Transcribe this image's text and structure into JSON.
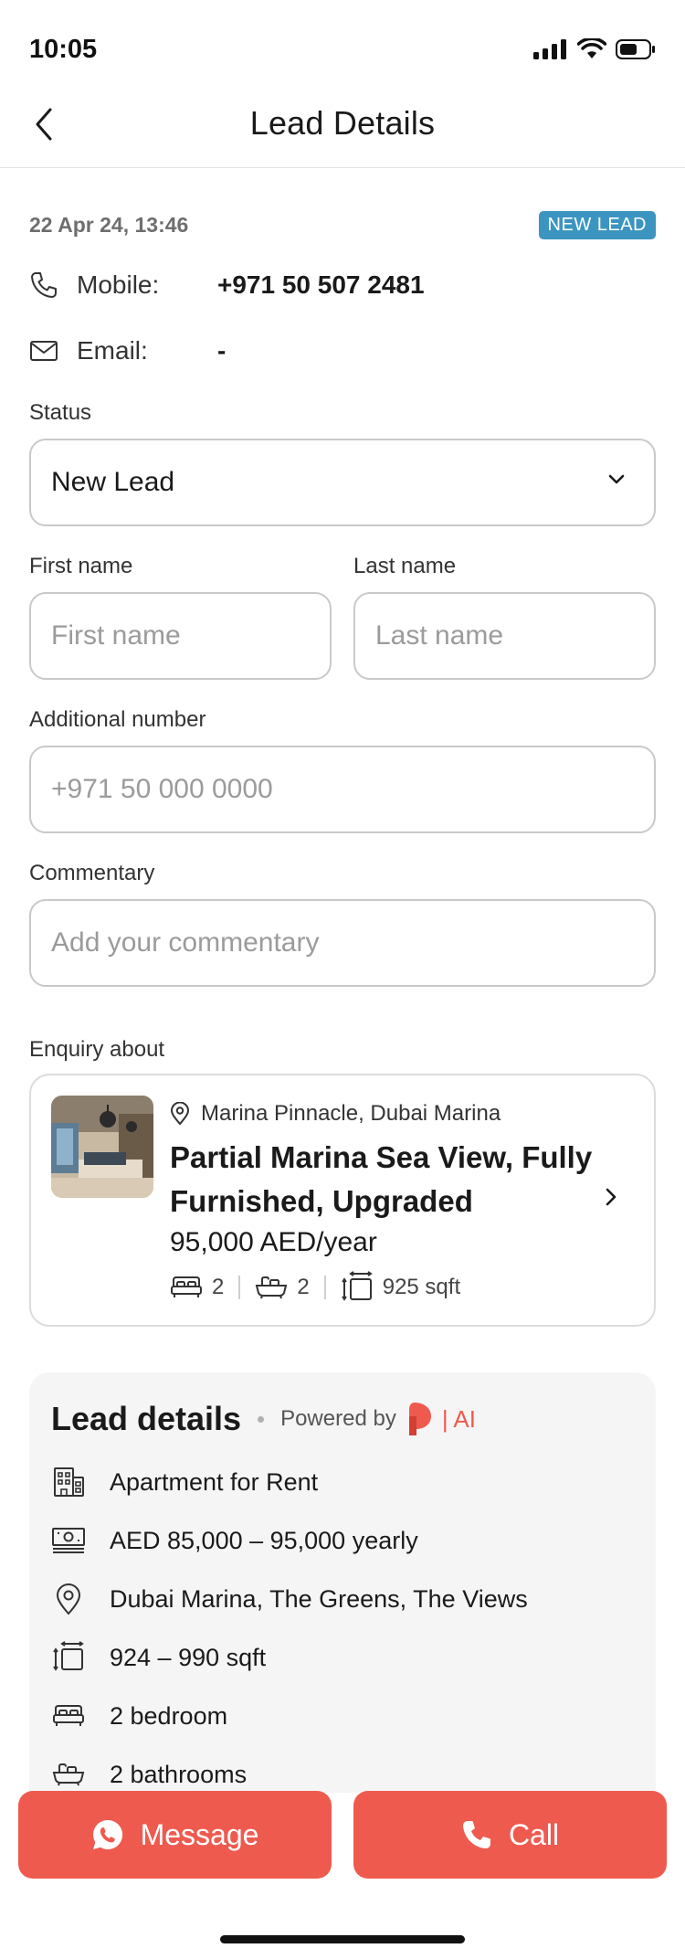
{
  "status_bar": {
    "time": "10:05"
  },
  "nav": {
    "title": "Lead Details"
  },
  "lead": {
    "date": "22 Apr 24, 13:46",
    "badge": "NEW LEAD",
    "mobile_label": "Mobile:",
    "mobile_value": "+971 50 507 2481",
    "email_label": "Email:",
    "email_value": "-"
  },
  "form": {
    "status_label": "Status",
    "status_value": "New Lead",
    "first_name_label": "First name",
    "first_name_placeholder": "First name",
    "last_name_label": "Last name",
    "last_name_placeholder": "Last name",
    "additional_number_label": "Additional number",
    "additional_number_placeholder": "+971 50 000 0000",
    "commentary_label": "Commentary",
    "commentary_placeholder": "Add your commentary"
  },
  "enquiry": {
    "section_label": "Enquiry about",
    "location": "Marina Pinnacle, Dubai Marina",
    "title": "Partial Marina Sea View, Fully Furnished, Upgraded",
    "price": "95,000 AED/year",
    "bedrooms": "2",
    "bathrooms": "2",
    "area": "925 sqft"
  },
  "lead_details": {
    "title": "Lead details",
    "powered_by": "Powered by",
    "ai_label": "| AI",
    "items": [
      {
        "icon": "building-icon",
        "text": "Apartment for Rent"
      },
      {
        "icon": "money-icon",
        "text": "AED 85,000 – 95,000 yearly"
      },
      {
        "icon": "location-pin-icon",
        "text": "Dubai Marina, The Greens, The Views"
      },
      {
        "icon": "area-icon",
        "text": "924 – 990 sqft"
      },
      {
        "icon": "bed-icon",
        "text": "2 bedroom"
      },
      {
        "icon": "bath-icon",
        "text": "2 bathrooms"
      }
    ]
  },
  "actions": {
    "message_label": "Message",
    "call_label": "Call"
  },
  "colors": {
    "accent": "#ef5a4f",
    "badge": "#3b95c0",
    "panel": "#f5f5f5"
  }
}
